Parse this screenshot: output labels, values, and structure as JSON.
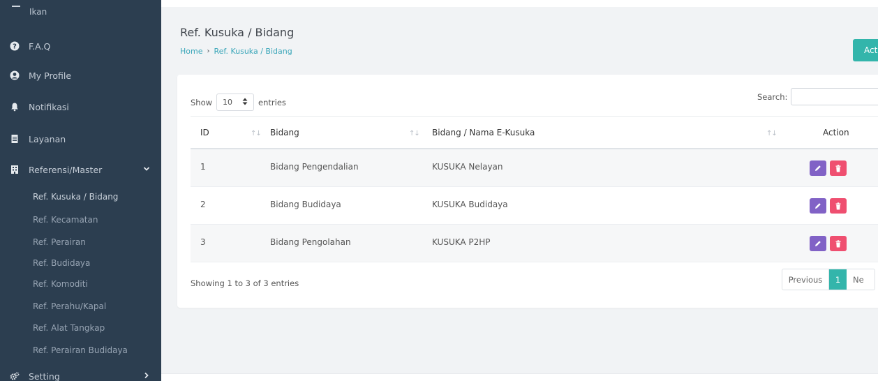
{
  "sidebar": {
    "top_partial_label": "Ikan",
    "items": [
      {
        "label": "F.A.Q",
        "icon": "question-circle-icon"
      },
      {
        "label": "My Profile",
        "icon": "user-circle-icon"
      },
      {
        "label": "Notifikasi",
        "icon": "bell-icon"
      },
      {
        "label": "Layanan",
        "icon": "document-icon"
      },
      {
        "label": "Referensi/Master",
        "icon": "building-icon",
        "chevron": "⌄"
      }
    ],
    "subitems": [
      "Ref. Kusuka / Bidang",
      "Ref. Kecamatan",
      "Ref. Perairan",
      "Ref. Budidaya",
      "Ref. Komoditi",
      "Ref. Perahu/Kapal",
      "Ref. Alat Tangkap",
      "Ref. Perairan Budidaya"
    ],
    "setting": {
      "label": "Setting",
      "icon": "gears-icon",
      "chevron": "›"
    }
  },
  "header": {
    "title": "Ref. Kusuka / Bidang",
    "breadcrumb": {
      "home": "Home",
      "separator": "›",
      "current": "Ref. Kusuka / Bidang"
    },
    "action_button": "Acti"
  },
  "table_controls": {
    "show_label": "Show",
    "length_value": "10",
    "entries_label": "entries",
    "search_label": "Search:"
  },
  "table": {
    "columns": [
      "ID",
      "Bidang",
      "Bidang / Nama E-Kusuka",
      "Action"
    ],
    "rows": [
      {
        "id": "1",
        "bidang": "Bidang Pengendalian",
        "nama": "KUSUKA Nelayan"
      },
      {
        "id": "2",
        "bidang": "Bidang Budidaya",
        "nama": "KUSUKA Budidaya"
      },
      {
        "id": "3",
        "bidang": "Bidang Pengolahan",
        "nama": "KUSUKA P2HP"
      }
    ]
  },
  "footer": {
    "info": "Showing 1 to 3 of 3 entries",
    "pagination": {
      "previous": "Previous",
      "current": "1",
      "next": "Ne"
    }
  },
  "colors": {
    "sidebar_bg": "#2c3e50",
    "accent_teal": "#33b5ab",
    "edit_purple": "#8162c6",
    "delete_red": "#ef4f70",
    "link": "#3aa6b9"
  }
}
